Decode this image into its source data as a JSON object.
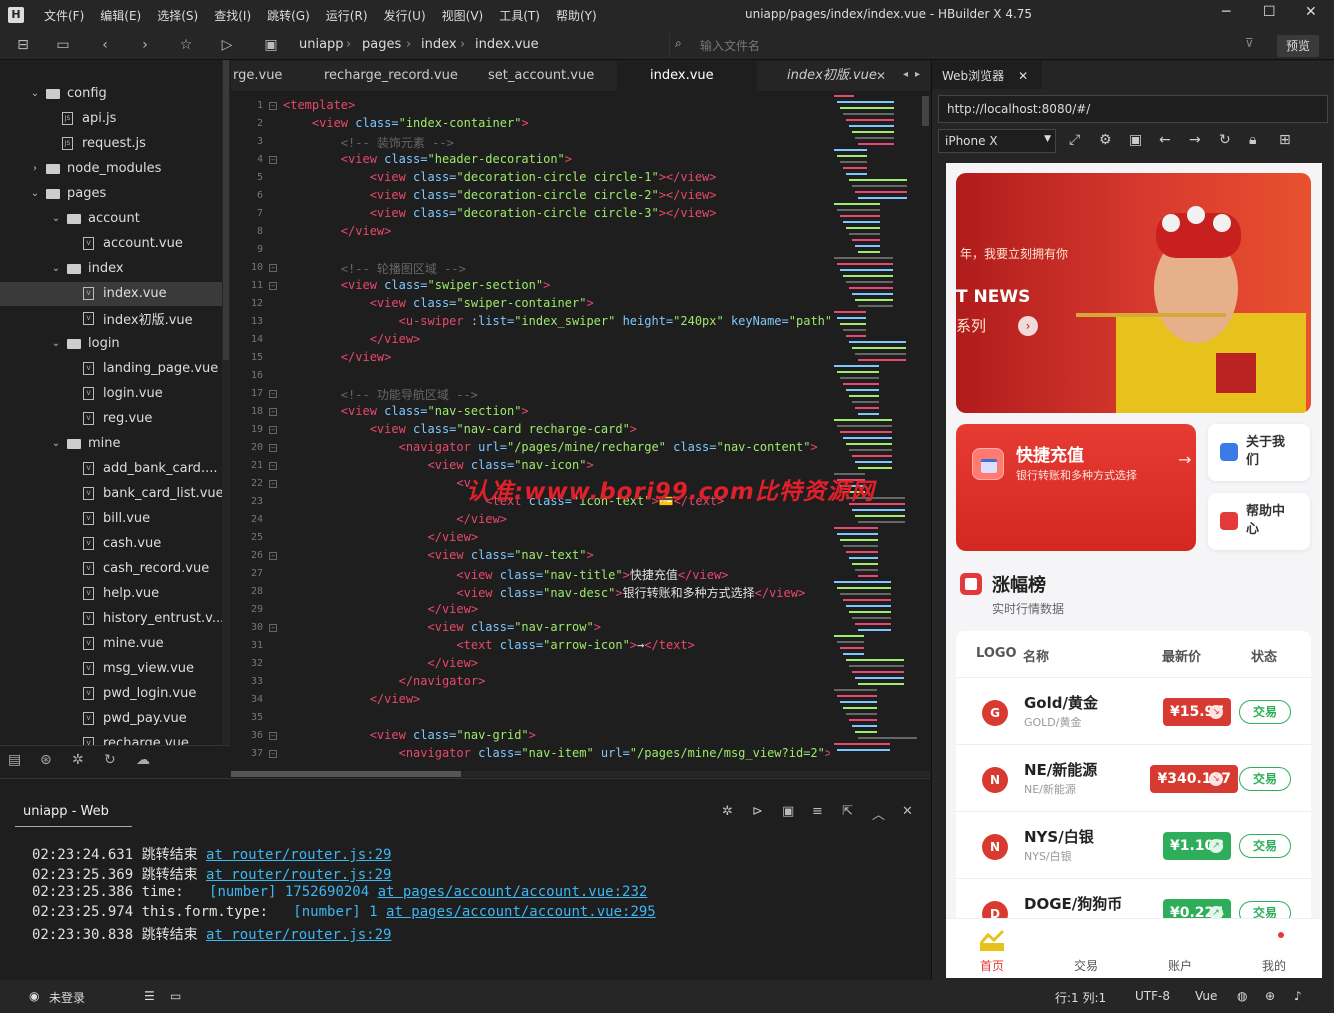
{
  "titlebar": {
    "menus": [
      "文件(F)",
      "编辑(E)",
      "选择(S)",
      "查找(I)",
      "跳转(G)",
      "运行(R)",
      "发行(U)",
      "视图(V)",
      "工具(T)",
      "帮助(Y)"
    ],
    "title": "uniapp/pages/index/index.vue - HBuilder X 4.75"
  },
  "toolbar": {
    "breadcrumb": [
      "uniapp",
      "pages",
      "index",
      "index.vue"
    ],
    "file_input_placeholder": "输入文件名",
    "preview_label": "预览"
  },
  "tree": [
    {
      "label": "config",
      "type": "folder",
      "open": true,
      "depth": 0
    },
    {
      "label": "api.js",
      "type": "file",
      "depth": 1
    },
    {
      "label": "request.js",
      "type": "file",
      "depth": 1
    },
    {
      "label": "node_modules",
      "type": "folder",
      "open": false,
      "depth": 0
    },
    {
      "label": "pages",
      "type": "folder",
      "open": true,
      "depth": 0
    },
    {
      "label": "account",
      "type": "folder",
      "open": true,
      "depth": 1
    },
    {
      "label": "account.vue",
      "type": "file",
      "depth": 2
    },
    {
      "label": "index",
      "type": "folder",
      "open": true,
      "depth": 1
    },
    {
      "label": "index.vue",
      "type": "file",
      "depth": 2,
      "selected": true
    },
    {
      "label": "index初版.vue",
      "type": "file",
      "depth": 2
    },
    {
      "label": "login",
      "type": "folder",
      "open": true,
      "depth": 1
    },
    {
      "label": "landing_page.vue",
      "type": "file",
      "depth": 2
    },
    {
      "label": "login.vue",
      "type": "file",
      "depth": 2
    },
    {
      "label": "reg.vue",
      "type": "file",
      "depth": 2
    },
    {
      "label": "mine",
      "type": "folder",
      "open": true,
      "depth": 1
    },
    {
      "label": "add_bank_card....",
      "type": "file",
      "depth": 2
    },
    {
      "label": "bank_card_list.vue",
      "type": "file",
      "depth": 2
    },
    {
      "label": "bill.vue",
      "type": "file",
      "depth": 2
    },
    {
      "label": "cash.vue",
      "type": "file",
      "depth": 2
    },
    {
      "label": "cash_record.vue",
      "type": "file",
      "depth": 2
    },
    {
      "label": "help.vue",
      "type": "file",
      "depth": 2
    },
    {
      "label": "history_entrust.v...",
      "type": "file",
      "depth": 2
    },
    {
      "label": "mine.vue",
      "type": "file",
      "depth": 2
    },
    {
      "label": "msg_view.vue",
      "type": "file",
      "depth": 2
    },
    {
      "label": "pwd_login.vue",
      "type": "file",
      "depth": 2
    },
    {
      "label": "pwd_pay.vue",
      "type": "file",
      "depth": 2
    },
    {
      "label": "recharge.vue",
      "type": "file",
      "depth": 2
    }
  ],
  "tabs": [
    "rge.vue",
    "recharge_record.vue",
    "set_account.vue",
    "index.vue",
    "index初版.vue"
  ],
  "code": [
    [
      [
        "tg",
        "<template>"
      ]
    ],
    [
      [
        "pn",
        "    "
      ],
      [
        "tg",
        "<view"
      ],
      [
        "at",
        " class="
      ],
      [
        "st",
        "\"index-container\""
      ],
      [
        "tg",
        ">"
      ]
    ],
    [
      [
        "pn",
        "        "
      ],
      [
        "cm",
        "<!-- 装饰元素 -->"
      ]
    ],
    [
      [
        "pn",
        "        "
      ],
      [
        "tg",
        "<view"
      ],
      [
        "at",
        " class="
      ],
      [
        "st",
        "\"header-decoration\""
      ],
      [
        "tg",
        ">"
      ]
    ],
    [
      [
        "pn",
        "            "
      ],
      [
        "tg",
        "<view"
      ],
      [
        "at",
        " class="
      ],
      [
        "st",
        "\"decoration-circle circle-1\""
      ],
      [
        "tg",
        "></view>"
      ]
    ],
    [
      [
        "pn",
        "            "
      ],
      [
        "tg",
        "<view"
      ],
      [
        "at",
        " class="
      ],
      [
        "st",
        "\"decoration-circle circle-2\""
      ],
      [
        "tg",
        "></view>"
      ]
    ],
    [
      [
        "pn",
        "            "
      ],
      [
        "tg",
        "<view"
      ],
      [
        "at",
        " class="
      ],
      [
        "st",
        "\"decoration-circle circle-3\""
      ],
      [
        "tg",
        "></view>"
      ]
    ],
    [
      [
        "pn",
        "        "
      ],
      [
        "tg",
        "</view>"
      ]
    ],
    [
      [
        "pn",
        ""
      ]
    ],
    [
      [
        "pn",
        "        "
      ],
      [
        "cm",
        "<!-- 轮播图区域 -->"
      ]
    ],
    [
      [
        "pn",
        "        "
      ],
      [
        "tg",
        "<view"
      ],
      [
        "at",
        " class="
      ],
      [
        "st",
        "\"swiper-section\""
      ],
      [
        "tg",
        ">"
      ]
    ],
    [
      [
        "pn",
        "            "
      ],
      [
        "tg",
        "<view"
      ],
      [
        "at",
        " class="
      ],
      [
        "st",
        "\"swiper-container\""
      ],
      [
        "tg",
        ">"
      ]
    ],
    [
      [
        "pn",
        "                "
      ],
      [
        "tg",
        "<u-swiper"
      ],
      [
        "at",
        " :list="
      ],
      [
        "st",
        "\"index_swiper\""
      ],
      [
        "at",
        " height="
      ],
      [
        "st",
        "\"240px\""
      ],
      [
        "at",
        " keyName="
      ],
      [
        "st",
        "\"path\""
      ],
      [
        "pn",
        " :"
      ]
    ],
    [
      [
        "pn",
        "            "
      ],
      [
        "tg",
        "</view>"
      ]
    ],
    [
      [
        "pn",
        "        "
      ],
      [
        "tg",
        "</view>"
      ]
    ],
    [
      [
        "pn",
        ""
      ]
    ],
    [
      [
        "pn",
        "        "
      ],
      [
        "cm",
        "<!-- 功能导航区域 -->"
      ]
    ],
    [
      [
        "pn",
        "        "
      ],
      [
        "tg",
        "<view"
      ],
      [
        "at",
        " class="
      ],
      [
        "st",
        "\"nav-section\""
      ],
      [
        "tg",
        ">"
      ]
    ],
    [
      [
        "pn",
        "            "
      ],
      [
        "tg",
        "<view"
      ],
      [
        "at",
        " class="
      ],
      [
        "st",
        "\"nav-card recharge-card\""
      ],
      [
        "tg",
        ">"
      ]
    ],
    [
      [
        "pn",
        "                "
      ],
      [
        "tg",
        "<navigator"
      ],
      [
        "at",
        " url="
      ],
      [
        "st",
        "\"/pages/mine/recharge\""
      ],
      [
        "at",
        " class="
      ],
      [
        "st",
        "\"nav-content\""
      ],
      [
        "tg",
        ">"
      ]
    ],
    [
      [
        "pn",
        "                    "
      ],
      [
        "tg",
        "<view"
      ],
      [
        "at",
        " class="
      ],
      [
        "st",
        "\"nav-icon\""
      ],
      [
        "tg",
        ">"
      ]
    ],
    [
      [
        "pn",
        "                        "
      ],
      [
        "tg",
        "<v"
      ]
    ],
    [
      [
        "pn",
        "                            "
      ],
      [
        "tg",
        "<text"
      ],
      [
        "at",
        " class="
      ],
      [
        "st",
        "\"icon-text\""
      ],
      [
        "tg",
        ">"
      ],
      [
        "pn",
        "💳"
      ],
      [
        "tg",
        "</text>"
      ]
    ],
    [
      [
        "pn",
        "                        "
      ],
      [
        "tg",
        "</view>"
      ]
    ],
    [
      [
        "pn",
        "                    "
      ],
      [
        "tg",
        "</view>"
      ]
    ],
    [
      [
        "pn",
        "                    "
      ],
      [
        "tg",
        "<view"
      ],
      [
        "at",
        " class="
      ],
      [
        "st",
        "\"nav-text\""
      ],
      [
        "tg",
        ">"
      ]
    ],
    [
      [
        "pn",
        "                        "
      ],
      [
        "tg",
        "<view"
      ],
      [
        "at",
        " class="
      ],
      [
        "st",
        "\"nav-title\""
      ],
      [
        "tg",
        ">"
      ],
      [
        "pn",
        "快捷充值"
      ],
      [
        "tg",
        "</view>"
      ]
    ],
    [
      [
        "pn",
        "                        "
      ],
      [
        "tg",
        "<view"
      ],
      [
        "at",
        " class="
      ],
      [
        "st",
        "\"nav-desc\""
      ],
      [
        "tg",
        ">"
      ],
      [
        "pn",
        "银行转账和多种方式选择"
      ],
      [
        "tg",
        "</view>"
      ]
    ],
    [
      [
        "pn",
        "                    "
      ],
      [
        "tg",
        "</view>"
      ]
    ],
    [
      [
        "pn",
        "                    "
      ],
      [
        "tg",
        "<view"
      ],
      [
        "at",
        " class="
      ],
      [
        "st",
        "\"nav-arrow\""
      ],
      [
        "tg",
        ">"
      ]
    ],
    [
      [
        "pn",
        "                        "
      ],
      [
        "tg",
        "<text"
      ],
      [
        "at",
        " class="
      ],
      [
        "st",
        "\"arrow-icon\""
      ],
      [
        "tg",
        ">"
      ],
      [
        "pn",
        "→"
      ],
      [
        "tg",
        "</text>"
      ]
    ],
    [
      [
        "pn",
        "                    "
      ],
      [
        "tg",
        "</view>"
      ]
    ],
    [
      [
        "pn",
        "                "
      ],
      [
        "tg",
        "</navigator>"
      ]
    ],
    [
      [
        "pn",
        "            "
      ],
      [
        "tg",
        "</view>"
      ]
    ],
    [
      [
        "pn",
        ""
      ]
    ],
    [
      [
        "pn",
        "            "
      ],
      [
        "tg",
        "<view"
      ],
      [
        "at",
        " class="
      ],
      [
        "st",
        "\"nav-grid\""
      ],
      [
        "tg",
        ">"
      ]
    ],
    [
      [
        "pn",
        "                "
      ],
      [
        "tg",
        "<navigator"
      ],
      [
        "at",
        " class="
      ],
      [
        "st",
        "\"nav-item\""
      ],
      [
        "at",
        " url="
      ],
      [
        "st",
        "\"/pages/mine/msg_view?id=2\""
      ],
      [
        "tg",
        ">"
      ]
    ]
  ],
  "console": {
    "title": "uniapp - Web",
    "lines": [
      {
        "time": "02:23:24.631",
        "msg": "跳转结束",
        "num": "",
        "link": "at router/router.js:29"
      },
      {
        "time": "02:23:25.369",
        "msg": "跳转结束",
        "num": "",
        "link": "at router/router.js:29"
      },
      {
        "time": "02:23:25.386",
        "msg": "time:  ",
        "num": "[number] 1752690204",
        "link": "at pages/account/account.vue:232"
      },
      {
        "time": "02:23:25.974",
        "msg": "this.form.type:  ",
        "num": "[number] 1",
        "link": "at pages/account/account.vue:295"
      },
      {
        "time": "02:23:30.838",
        "msg": "跳转结束",
        "num": "",
        "link": "at router/router.js:29"
      }
    ]
  },
  "statusbar": {
    "login": "未登录",
    "pos": "行:1  列:1",
    "enc": "UTF-8",
    "lang": "Vue"
  },
  "browser": {
    "tab": "Web浏览器",
    "url": "http://localhost:8080/#/",
    "device": "iPhone X"
  },
  "app": {
    "banner": {
      "t1": "年，我要立刻拥有你",
      "t2": "T NEWS",
      "t3": "系列"
    },
    "quick": {
      "title": "快捷充值",
      "desc": "银行转账和多种方式选择",
      "arrow": "→"
    },
    "side": [
      {
        "label": "关于我们",
        "color": "#3a7be8"
      },
      {
        "label": "帮助中心",
        "color": "#e23a3a"
      }
    ],
    "rank": {
      "title": "涨幅榜",
      "sub": "实时行情数据",
      "headers": [
        "LOGO",
        "名称",
        "最新价",
        "状态"
      ]
    },
    "rows": [
      {
        "letter": "G",
        "name": "Gold/黄金",
        "sub": "GOLD/黄金",
        "price": "¥15.97",
        "up": false,
        "btn": "交易"
      },
      {
        "letter": "N",
        "name": "NE/新能源",
        "sub": "NE/新能源",
        "price": "¥340.137",
        "up": false,
        "btn": "交易"
      },
      {
        "letter": "N",
        "name": "NYS/白银",
        "sub": "NYS/白银",
        "price": "¥1.108",
        "up": true,
        "btn": "交易"
      },
      {
        "letter": "D",
        "name": "DOGE/狗狗币",
        "sub": "",
        "price": "¥0.224",
        "up": true,
        "btn": "交易"
      }
    ],
    "nav": [
      "首页",
      "交易",
      "账户",
      "我的"
    ]
  },
  "watermark": "认准:www.bori99.com比特资源网",
  "colors": {
    "down": "#d63a30",
    "up": "#2eae5b",
    "accent": "#e23a3a"
  }
}
